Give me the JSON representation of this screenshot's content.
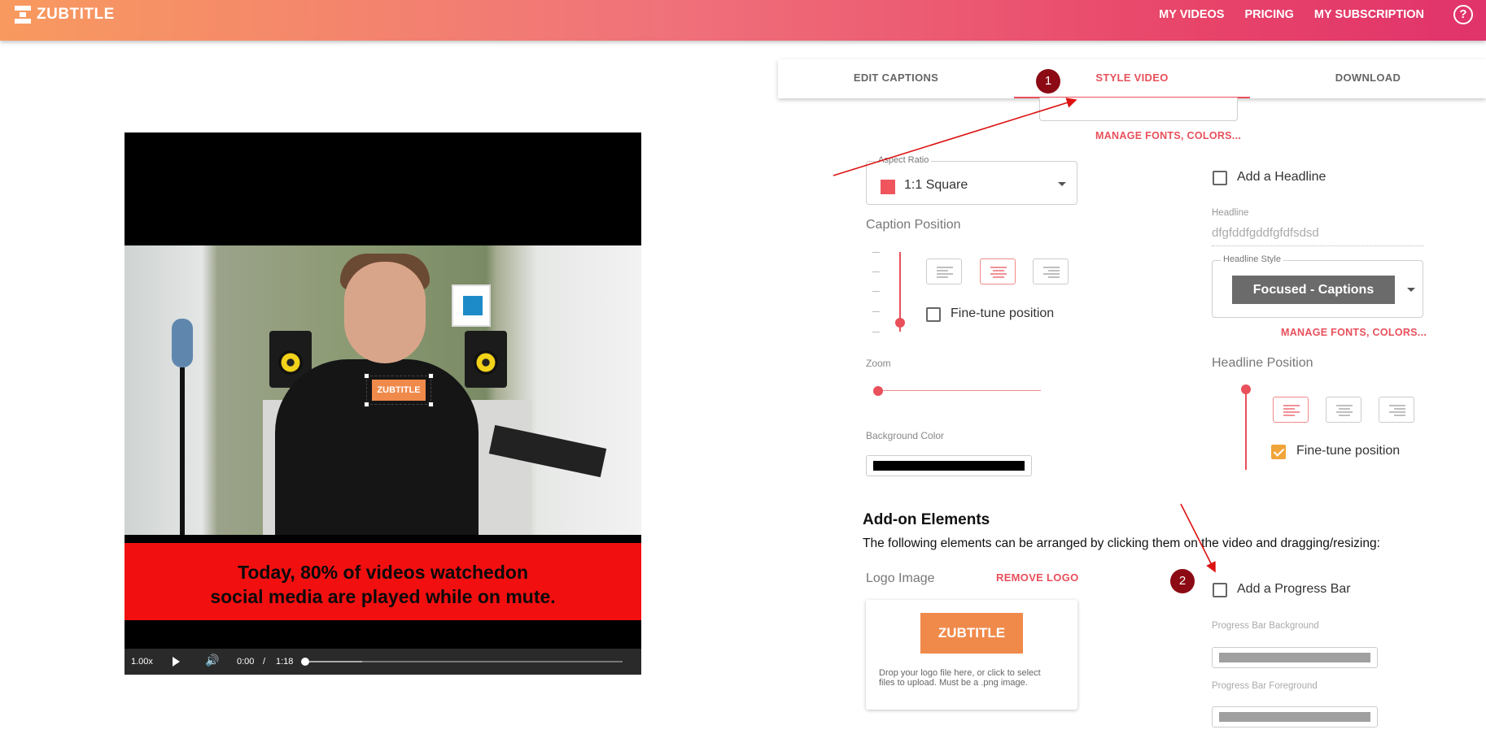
{
  "brand": {
    "name": "ZUBTITLE"
  },
  "nav": {
    "my_videos": "MY VIDEOS",
    "pricing": "PRICING",
    "my_subscription": "MY SUBSCRIPTION",
    "help": "?"
  },
  "tabs": [
    {
      "label": "EDIT CAPTIONS",
      "active": false
    },
    {
      "label": "STYLE VIDEO",
      "active": true
    },
    {
      "label": "DOWNLOAD",
      "active": false
    }
  ],
  "annotations": {
    "marker_1": "1",
    "marker_2": "2",
    "color": "#8b0a14"
  },
  "video": {
    "watermark": "ZUBTITLE",
    "caption_line1": "Today, 80% of videos watchedon",
    "caption_line2": "social media are played while on mute.",
    "caption_bg": "#f20f10",
    "speed": "1.00x",
    "current_time": "0:00",
    "separator": "/",
    "duration": "1:18"
  },
  "style": {
    "manage_fonts_link": "MANAGE FONTS, COLORS...",
    "aspect_ratio_label": "Aspect Ratio",
    "aspect_ratio_value": "1:1 Square",
    "aspect_ratio_color": "#f0555e",
    "caption_position_label": "Caption Position",
    "caption_align_selected": "center",
    "fine_tune_label": "Fine-tune position",
    "fine_tune_checked": false,
    "zoom_label": "Zoom",
    "background_color_label": "Background Color",
    "background_color": "#000000"
  },
  "headline": {
    "add_label": "Add a Headline",
    "add_checked": false,
    "field_label": "Headline",
    "field_value": "dfgfddfgddfgfdfsdsd",
    "style_label": "Headline Style",
    "style_value": "Focused - Captions",
    "manage_fonts_link": "MANAGE FONTS, COLORS...",
    "position_label": "Headline Position",
    "position_align_selected": "left",
    "fine_tune_label": "Fine-tune position",
    "fine_tune_checked": true
  },
  "addons": {
    "title": "Add-on Elements",
    "description": "The following elements can be arranged by clicking them on the video and dragging/resizing:",
    "logo_label": "Logo Image",
    "remove_logo": "REMOVE LOGO",
    "logo_preview_text": "ZUBTITLE",
    "logo_hint": "Drop your logo file here, or click to select files to upload. Must be a .png image.",
    "progress_bar_label": "Add a Progress Bar",
    "progress_bar_checked": false,
    "progress_bg_label": "Progress Bar Background",
    "progress_bg_color": "#a0a0a0",
    "progress_fg_label": "Progress Bar Foreground",
    "progress_fg_color": "#a0a0a0"
  }
}
